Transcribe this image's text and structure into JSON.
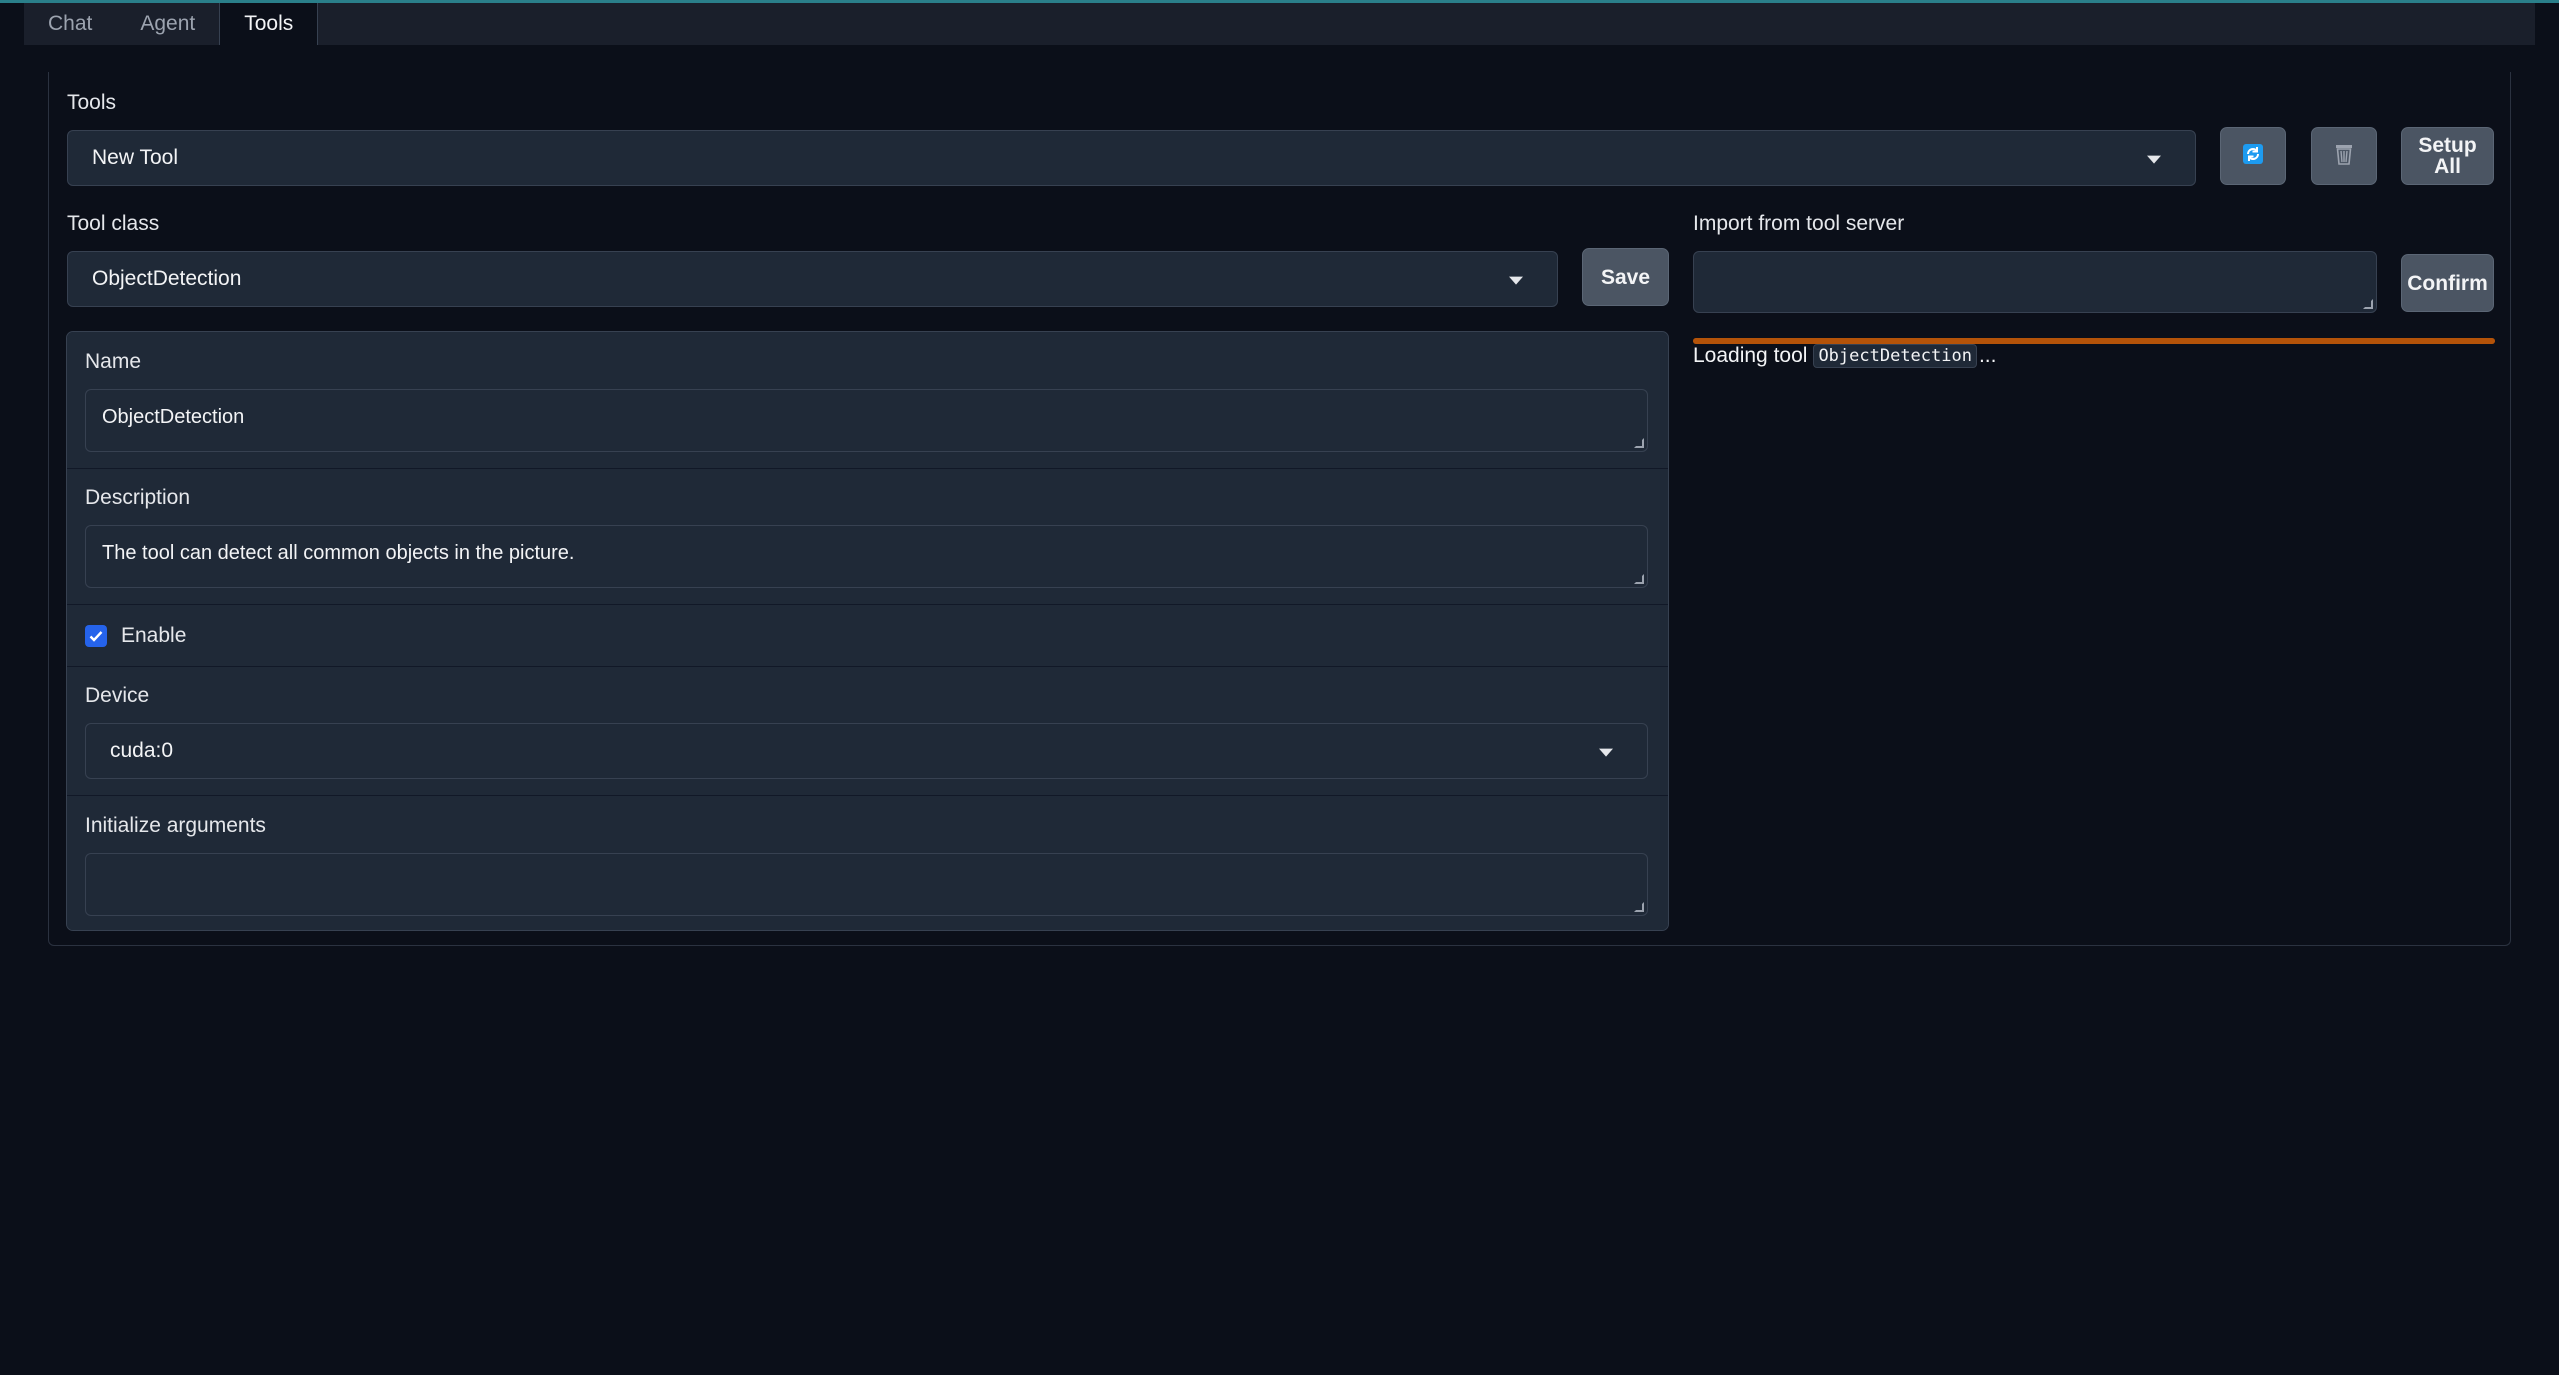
{
  "tabs": [
    {
      "label": "Chat",
      "active": false
    },
    {
      "label": "Agent",
      "active": false
    },
    {
      "label": "Tools",
      "active": true
    }
  ],
  "tools": {
    "label": "Tools",
    "selected": "New Tool",
    "refresh_icon": "refresh-icon",
    "delete_icon": "trash-icon",
    "setup_all_label": "Setup All"
  },
  "tool_class": {
    "label": "Tool class",
    "selected": "ObjectDetection",
    "save_label": "Save"
  },
  "import": {
    "label": "Import from tool server",
    "value": "",
    "confirm_label": "Confirm"
  },
  "status": {
    "prefix": "Loading tool",
    "tool_name": "ObjectDetection",
    "suffix": "...",
    "progress": 1.0
  },
  "form": {
    "name_label": "Name",
    "name_value": "ObjectDetection",
    "description_label": "Description",
    "description_value": "The tool can detect all common objects in the picture.",
    "enable_label": "Enable",
    "enable_checked": true,
    "device_label": "Device",
    "device_value": "cuda:0",
    "init_args_label": "Initialize arguments",
    "init_args_value": ""
  },
  "colors": {
    "accent": "#2563eb",
    "progress": "#b45309",
    "background": "#0b0f19",
    "surface": "#1f2937"
  }
}
